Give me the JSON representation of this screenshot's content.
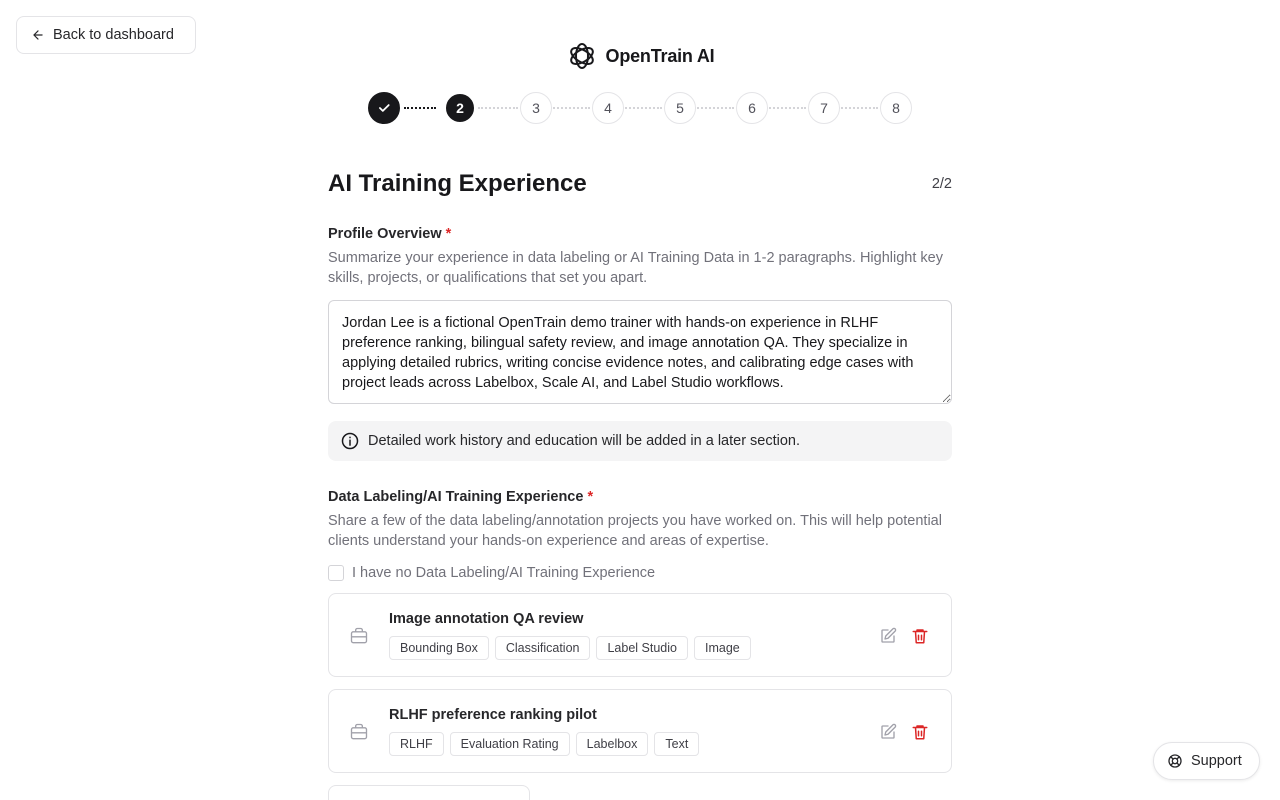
{
  "header": {
    "back_label": "Back to dashboard",
    "brand": "OpenTrain AI"
  },
  "stepper": {
    "steps": [
      "1",
      "2",
      "3",
      "4",
      "5",
      "6",
      "7",
      "8"
    ],
    "current": 2
  },
  "page": {
    "title": "AI Training Experience",
    "counter": "2/2"
  },
  "profile": {
    "label": "Profile Overview",
    "required_mark": "*",
    "help": "Summarize your experience in data labeling or AI Training Data in 1-2 paragraphs. Highlight key skills, projects, or qualifications that set you apart.",
    "value": "Jordan Lee is a fictional OpenTrain demo trainer with hands-on experience in RLHF preference ranking, bilingual safety review, and image annotation QA. They specialize in applying detailed rubrics, writing concise evidence notes, and calibrating edge cases with project leads across Labelbox, Scale AI, and Label Studio workflows.",
    "info": "Detailed work history and education will be added in a later section."
  },
  "experience": {
    "label": "Data Labeling/AI Training Experience",
    "required_mark": "*",
    "help": "Share a few of the data labeling/annotation projects you have worked on. This will help potential clients understand your hands-on experience and areas of expertise.",
    "no_experience_label": "I have no Data Labeling/AI Training Experience",
    "no_experience_checked": false,
    "projects": [
      {
        "title": "Image annotation QA review",
        "tags": [
          "Bounding Box",
          "Classification",
          "Label Studio",
          "Image"
        ]
      },
      {
        "title": "RLHF preference ranking pilot",
        "tags": [
          "RLHF",
          "Evaluation Rating",
          "Labelbox",
          "Text"
        ]
      }
    ]
  },
  "support": {
    "label": "Support"
  },
  "colors": {
    "primary": "#18181b",
    "required": "#dc2626",
    "delete": "#dc2626",
    "muted_text": "#71717a",
    "border": "#e4e4e7"
  }
}
